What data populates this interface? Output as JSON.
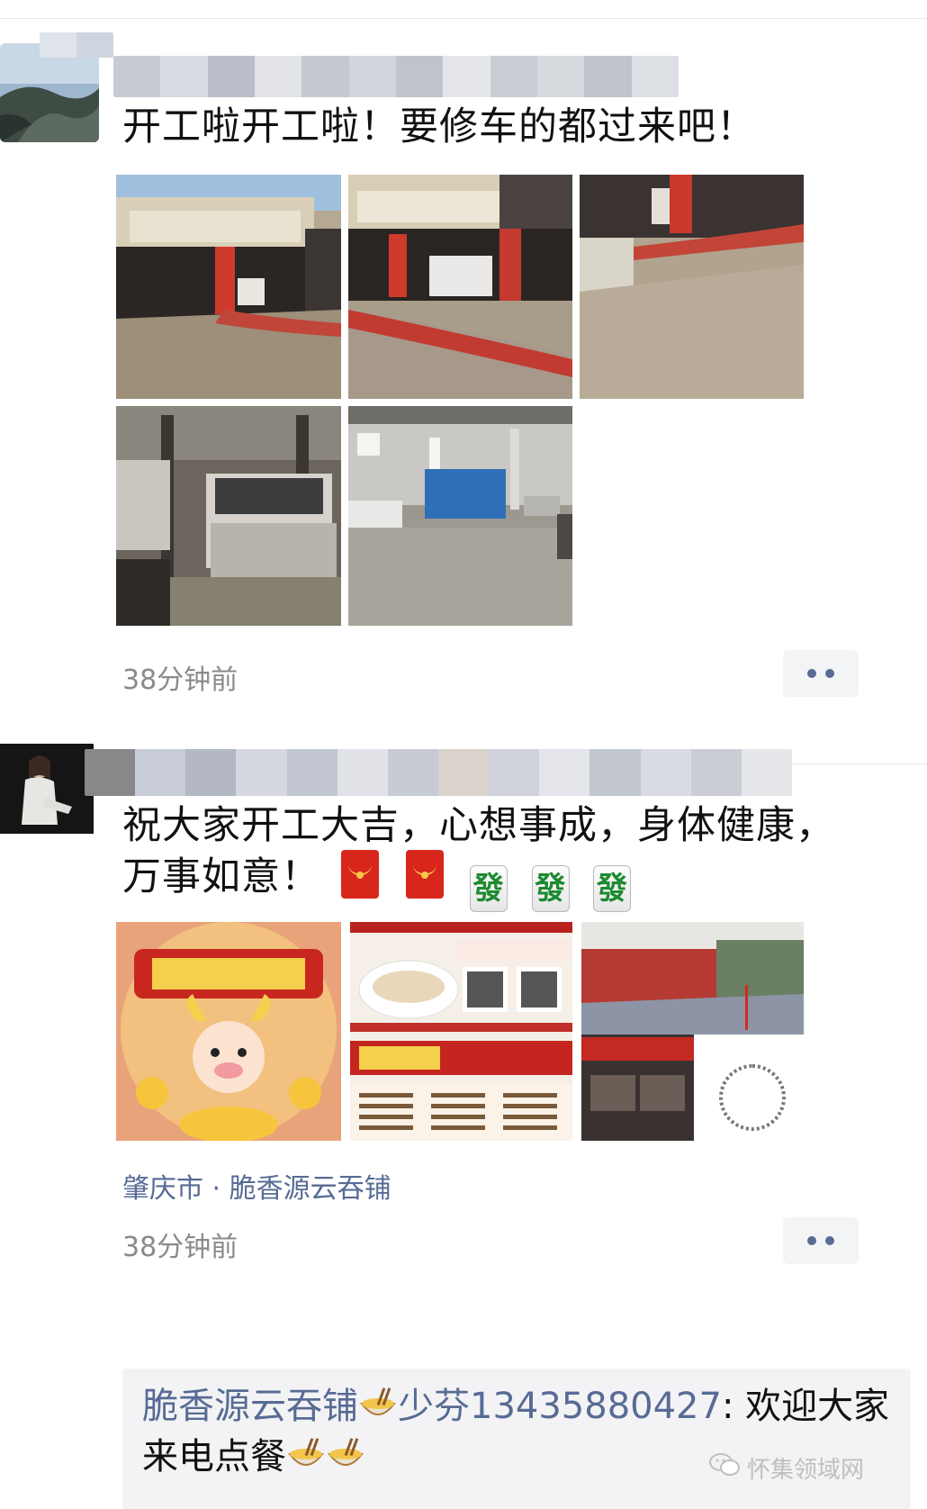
{
  "posts": [
    {
      "text": "开工啦开工啦！要修车的都过来吧！",
      "time": "38分钟前"
    },
    {
      "text_line1": "祝大家开工大吉，心想事成，身体健康，",
      "text_line2": "万事如意！",
      "emoji_fa": "發",
      "location": "肇庆市 · 脆香源云吞铺",
      "time": "38分钟前",
      "comment": {
        "name_part1": "脆香源云吞铺",
        "name_part2": "少芬13435880427",
        "text_line1_tail": ": 欢迎大家",
        "text_line2": "来电点餐"
      }
    }
  ],
  "watermark": "怀集领域网",
  "colors": {
    "link": "#576b95",
    "meta": "#8a8a8a"
  }
}
